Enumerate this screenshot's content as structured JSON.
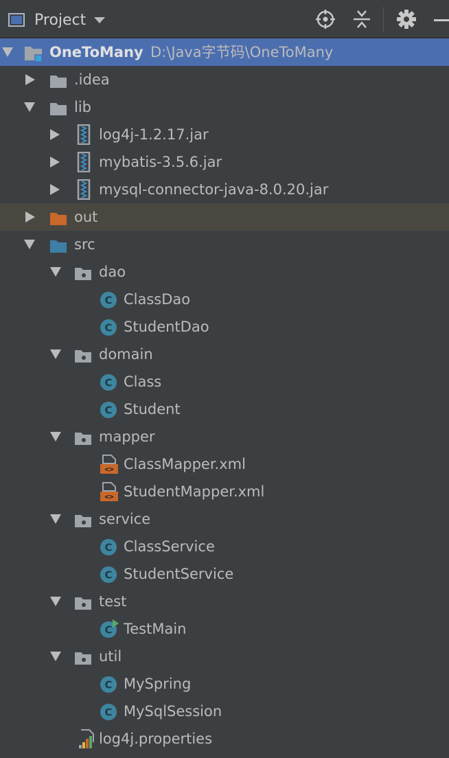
{
  "toolbar": {
    "title": "Project",
    "icons": [
      "project-window-icon",
      "dropdown-caret-icon",
      "locate-icon",
      "collapse-all-icon",
      "settings-gear-icon",
      "minimize-icon"
    ]
  },
  "colors": {
    "background": "#3c3f41",
    "selection": "#4b6eaf",
    "excluded_row": "#4a4740",
    "folder_gray": "#a0a5ab",
    "folder_orange": "#c8682b",
    "folder_blue": "#3d7fa6",
    "class_badge": "#3e86a0",
    "xml_orange": "#c8682b"
  },
  "tree": {
    "root": {
      "name": "OneToMany",
      "path": "D:\\Java字节码\\OneToMany"
    },
    "idea": {
      "name": ".idea"
    },
    "lib": {
      "name": "lib"
    },
    "jar1": {
      "name": "log4j-1.2.17.jar"
    },
    "jar2": {
      "name": "mybatis-3.5.6.jar"
    },
    "jar3": {
      "name": "mysql-connector-java-8.0.20.jar"
    },
    "out": {
      "name": "out"
    },
    "src": {
      "name": "src"
    },
    "dao": {
      "name": "dao"
    },
    "dao_c1": {
      "name": "ClassDao"
    },
    "dao_c2": {
      "name": "StudentDao"
    },
    "domain": {
      "name": "domain"
    },
    "domain_c1": {
      "name": "Class"
    },
    "domain_c2": {
      "name": "Student"
    },
    "mapper": {
      "name": "mapper"
    },
    "mapper_x1": {
      "name": "ClassMapper.xml"
    },
    "mapper_x2": {
      "name": "StudentMapper.xml"
    },
    "service": {
      "name": "service"
    },
    "service_c1": {
      "name": "ClassService"
    },
    "service_c2": {
      "name": "StudentService"
    },
    "test": {
      "name": "test"
    },
    "test_c1": {
      "name": "TestMain"
    },
    "util": {
      "name": "util"
    },
    "util_c1": {
      "name": "MySpring"
    },
    "util_c2": {
      "name": "MySqlSession"
    },
    "props": {
      "name": "log4j.properties"
    }
  }
}
